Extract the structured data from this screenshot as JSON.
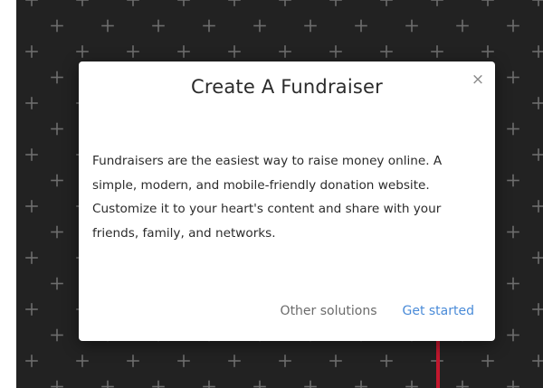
{
  "background": {
    "color": "#222222",
    "pattern_icon": "plus-icon",
    "pattern_color": "#6e6e6e"
  },
  "modal": {
    "title": "Create A Fundraiser",
    "close_icon": "close-icon",
    "close_glyph": "×",
    "body": "Fundraisers are the easiest way to raise money online. A simple, modern, and mobile-friendly donation website. Customize it to your heart's content and share with your friends, family, and networks.",
    "actions": {
      "secondary_label": "Other solutions",
      "primary_label": "Get started"
    }
  },
  "colors": {
    "primary_link": "#4a8bd8",
    "secondary_link": "#6b6b6b",
    "pointer": "#c2172e"
  }
}
